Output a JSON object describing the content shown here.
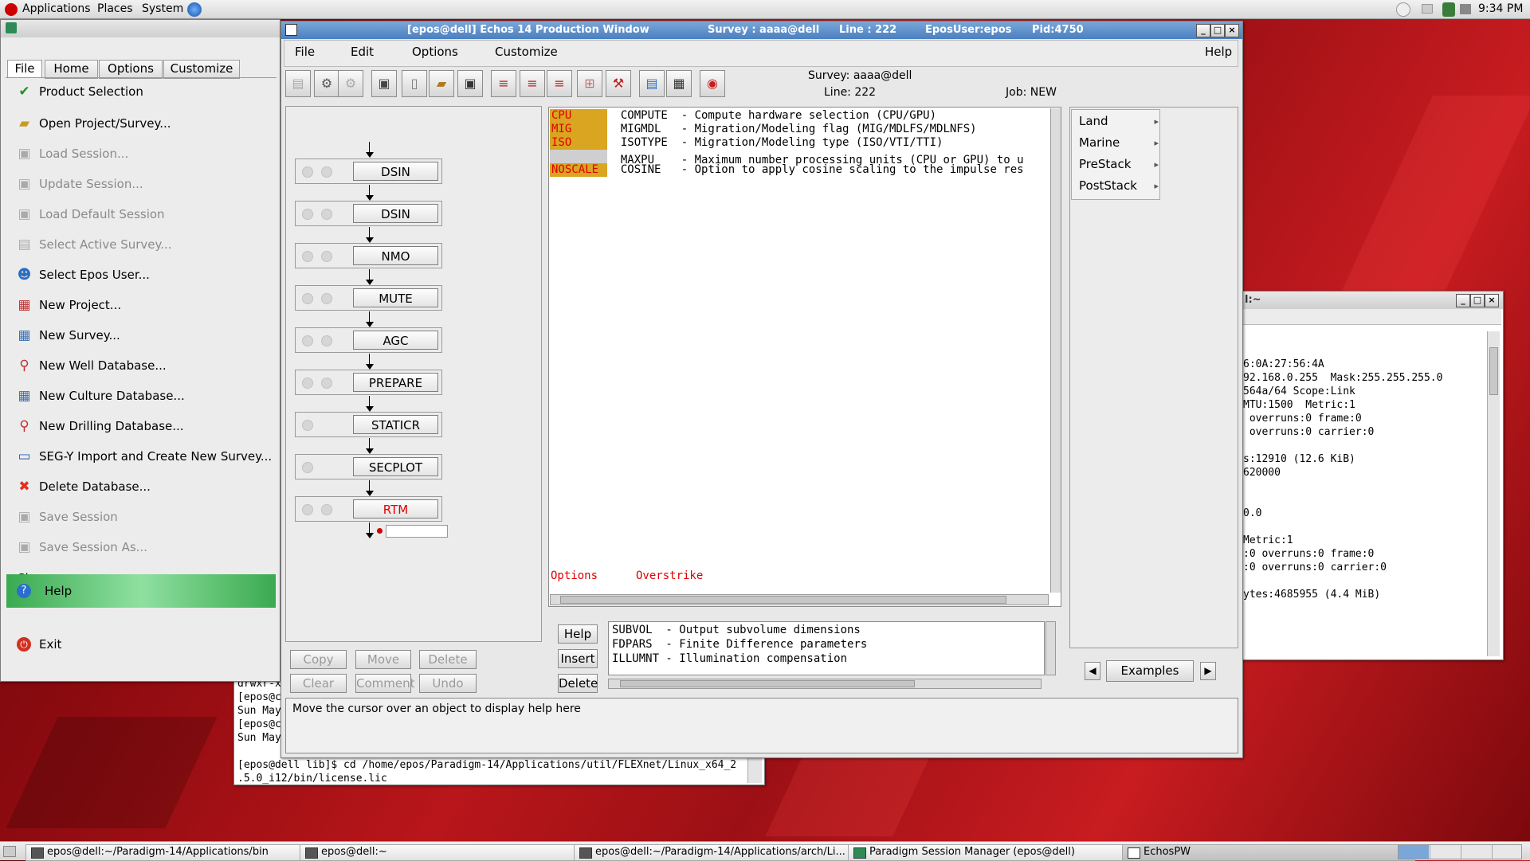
{
  "top_panel": {
    "menus": [
      "Applications",
      "Places",
      "System"
    ],
    "clock": "9:34 PM"
  },
  "session_manager": {
    "tabs": [
      "File",
      "Home",
      "Options",
      "Customize"
    ],
    "items": [
      {
        "label": "Product Selection",
        "icon": "check-icon",
        "enabled": true
      },
      {
        "label": "Open Project/Survey...",
        "icon": "folder-open-icon",
        "enabled": true
      },
      {
        "label": "Load Session...",
        "icon": "session-icon",
        "enabled": false
      },
      {
        "label": "Update Session...",
        "icon": "session-icon",
        "enabled": false
      },
      {
        "label": "Load Default Session",
        "icon": "session-icon",
        "enabled": false
      },
      {
        "label": "Select Active Survey...",
        "icon": "survey-icon",
        "enabled": false
      },
      {
        "label": "Select Epos User...",
        "icon": "users-icon",
        "enabled": true
      },
      {
        "label": "New Project...",
        "icon": "project-icon",
        "enabled": true
      },
      {
        "label": "New Survey...",
        "icon": "grid-icon",
        "enabled": true
      },
      {
        "label": "New Well Database...",
        "icon": "well-icon",
        "enabled": true
      },
      {
        "label": "New Culture Database...",
        "icon": "grid-icon",
        "enabled": true
      },
      {
        "label": "New Drilling Database...",
        "icon": "well-icon",
        "enabled": true
      },
      {
        "label": "SEG-Y Import and Create New Survey...",
        "icon": "segy-icon",
        "enabled": true
      },
      {
        "label": "Delete Database...",
        "icon": "delete-icon",
        "enabled": true
      },
      {
        "label": "Save Session",
        "icon": "save-icon",
        "enabled": false
      },
      {
        "label": "Save Session As...",
        "icon": "save-icon",
        "enabled": false
      }
    ],
    "close_label": "Close",
    "help_label": "Help",
    "exit_label": "Exit"
  },
  "echos": {
    "title": "[epos@dell] Echos 14 Production Window",
    "title_survey": "Survey : aaaa@dell",
    "title_line": "Line : 222",
    "title_user": "EposUser:epos",
    "title_pid": "Pid:4750",
    "menus": [
      "File",
      "Edit",
      "Options",
      "Customize"
    ],
    "help_menu": "Help",
    "info": {
      "survey": "Survey: aaaa@dell",
      "line": "Line: 222",
      "job": "Job: NEW"
    },
    "flow": [
      "DSIN",
      "DSIN",
      "NMO",
      "MUTE",
      "AGC",
      "PREPARE",
      "STATICR",
      "SECPLOT",
      "RTM"
    ],
    "params": [
      {
        "tag": "CPU",
        "text": "COMPUTE  - Compute hardware selection (CPU/GPU)"
      },
      {
        "tag": "MIG",
        "text": "MIGMDL   - Migration/Modeling flag (MIG/MDLFS/MDLNFS)"
      },
      {
        "tag": "ISO",
        "text": "ISOTYPE  - Migration/Modeling type (ISO/VTI/TTI)"
      },
      {
        "tag": "",
        "text": "MAXPU    - Maximum number processing units (CPU or GPU) to u"
      },
      {
        "tag": "NOSCALE",
        "text": "COSINE   - Option to apply cosine scaling to the impulse res"
      }
    ],
    "status_options": "Options",
    "status_overstrike": "Overstrike",
    "subparams": [
      "SUBVOL  - Output subvolume dimensions",
      "FDPARS  - Finite Difference parameters",
      "ILLUMNT - Illumination compensation"
    ],
    "side_buttons": [
      "Help",
      "Insert",
      "Delete"
    ],
    "flow_buttons": [
      "Copy",
      "Move",
      "Delete",
      "Clear",
      "Comment",
      "Undo"
    ],
    "categories": [
      "Land",
      "Marine",
      "PreStack",
      "PostStack"
    ],
    "examples_label": "Examples",
    "help_text": "Move the cursor over an object to display help here"
  },
  "terminal_right": {
    "title": "l:~",
    "lines": [
      "6:0A:27:56:4A",
      "92.168.0.255  Mask:255.255.255.0",
      "564a/64 Scope:Link",
      "MTU:1500  Metric:1",
      " overruns:0 frame:0",
      " overruns:0 carrier:0",
      "",
      "s:12910 (12.6 KiB)",
      "620000",
      "",
      "",
      "0.0",
      "",
      "Metric:1",
      ":0 overruns:0 frame:0",
      ":0 overruns:0 carrier:0",
      "",
      "ytes:4685955 (4.4 MiB)"
    ]
  },
  "terminal_back": {
    "lines": [
      "drwxr-x",
      "[epos@c",
      "Sun May",
      "[epos@c",
      "Sun May",
      "[epos@dell lib]$ cd /home/epos/Paradigm-14/Applications/util/FLEXnet/Linux_x64_2",
      ".5.0_i12/bin/license.lic"
    ]
  },
  "taskbar": [
    "epos@dell:~/Paradigm-14/Applications/bin",
    "epos@dell:~",
    "epos@dell:~/Paradigm-14/Applications/arch/Li...",
    "Paradigm Session Manager (epos@dell)",
    "EchosPW"
  ]
}
